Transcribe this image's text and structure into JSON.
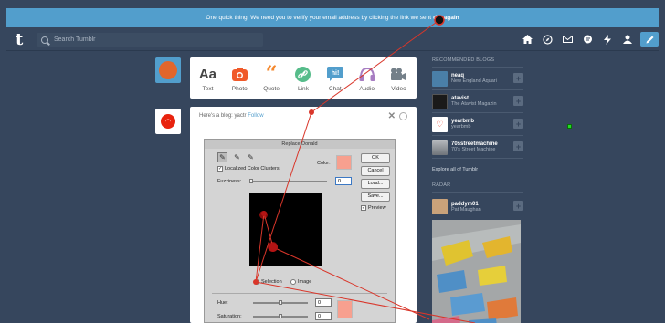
{
  "banner": {
    "text": "One quick thing: We need you to verify your email address by clicking the link we sent",
    "link": "d it again"
  },
  "header": {
    "logo": "t",
    "search_placeholder": "Search Tumblr",
    "icons": [
      "home-icon",
      "explore-icon",
      "inbox-icon",
      "messages-icon",
      "activity-icon",
      "account-icon",
      "compose-icon"
    ]
  },
  "post_types": [
    {
      "label": "Text",
      "glyph": "Aa",
      "color": "#444444"
    },
    {
      "label": "Photo",
      "glyph": "📷",
      "color": "#f05a2a"
    },
    {
      "label": "Quote",
      "glyph": "❝",
      "color": "#f4872c"
    },
    {
      "label": "Link",
      "glyph": "🔗",
      "color": "#56bc8a"
    },
    {
      "label": "Chat",
      "glyph": "hi!",
      "color": "#529ecc"
    },
    {
      "label": "Audio",
      "glyph": "🎧",
      "color": "#a77dc2"
    },
    {
      "label": "Video",
      "glyph": "🎥",
      "color": "#748089"
    }
  ],
  "post": {
    "text": "Here's a blog: yactr",
    "follow": "Follow"
  },
  "dialog": {
    "title": "Replace Donald",
    "localized": "Localized Color Clusters",
    "color_label": "Color:",
    "fuzziness_label": "Fuzziness:",
    "fuzziness_value": "0",
    "buttons": [
      "OK",
      "Cancel",
      "Load...",
      "Save..."
    ],
    "preview_label": "Preview",
    "selection_label": "Selection",
    "image_label": "Image",
    "hue_label": "Hue:",
    "hue_value": "0",
    "saturation_label": "Saturation:",
    "saturation_value": "0",
    "swatch_color": "#f7a08f"
  },
  "sidebar": {
    "recommended_title": "RECOMMENDED BLOGS",
    "blogs": [
      {
        "name": "neaq",
        "sub": "New England Aquari",
        "thumb": "#4a7fa8"
      },
      {
        "name": "atavist",
        "sub": "The Atavist Magazin",
        "thumb": "#1a1a1a"
      },
      {
        "name": "yearbmb",
        "sub": "yearbmb",
        "thumb": "#ffffff"
      },
      {
        "name": "70sstreetmachine",
        "sub": "70's Street Machine",
        "thumb": "#8a8e94"
      }
    ],
    "explore": "Explore all of Tumblr",
    "radar_title": "RADAR",
    "radar_user": "paddym01",
    "radar_sub": "Pat Maughan"
  },
  "colors": {
    "background": "#36465d",
    "banner": "#529ecc",
    "accent": "#529ecc",
    "trace": "#d9362a"
  }
}
